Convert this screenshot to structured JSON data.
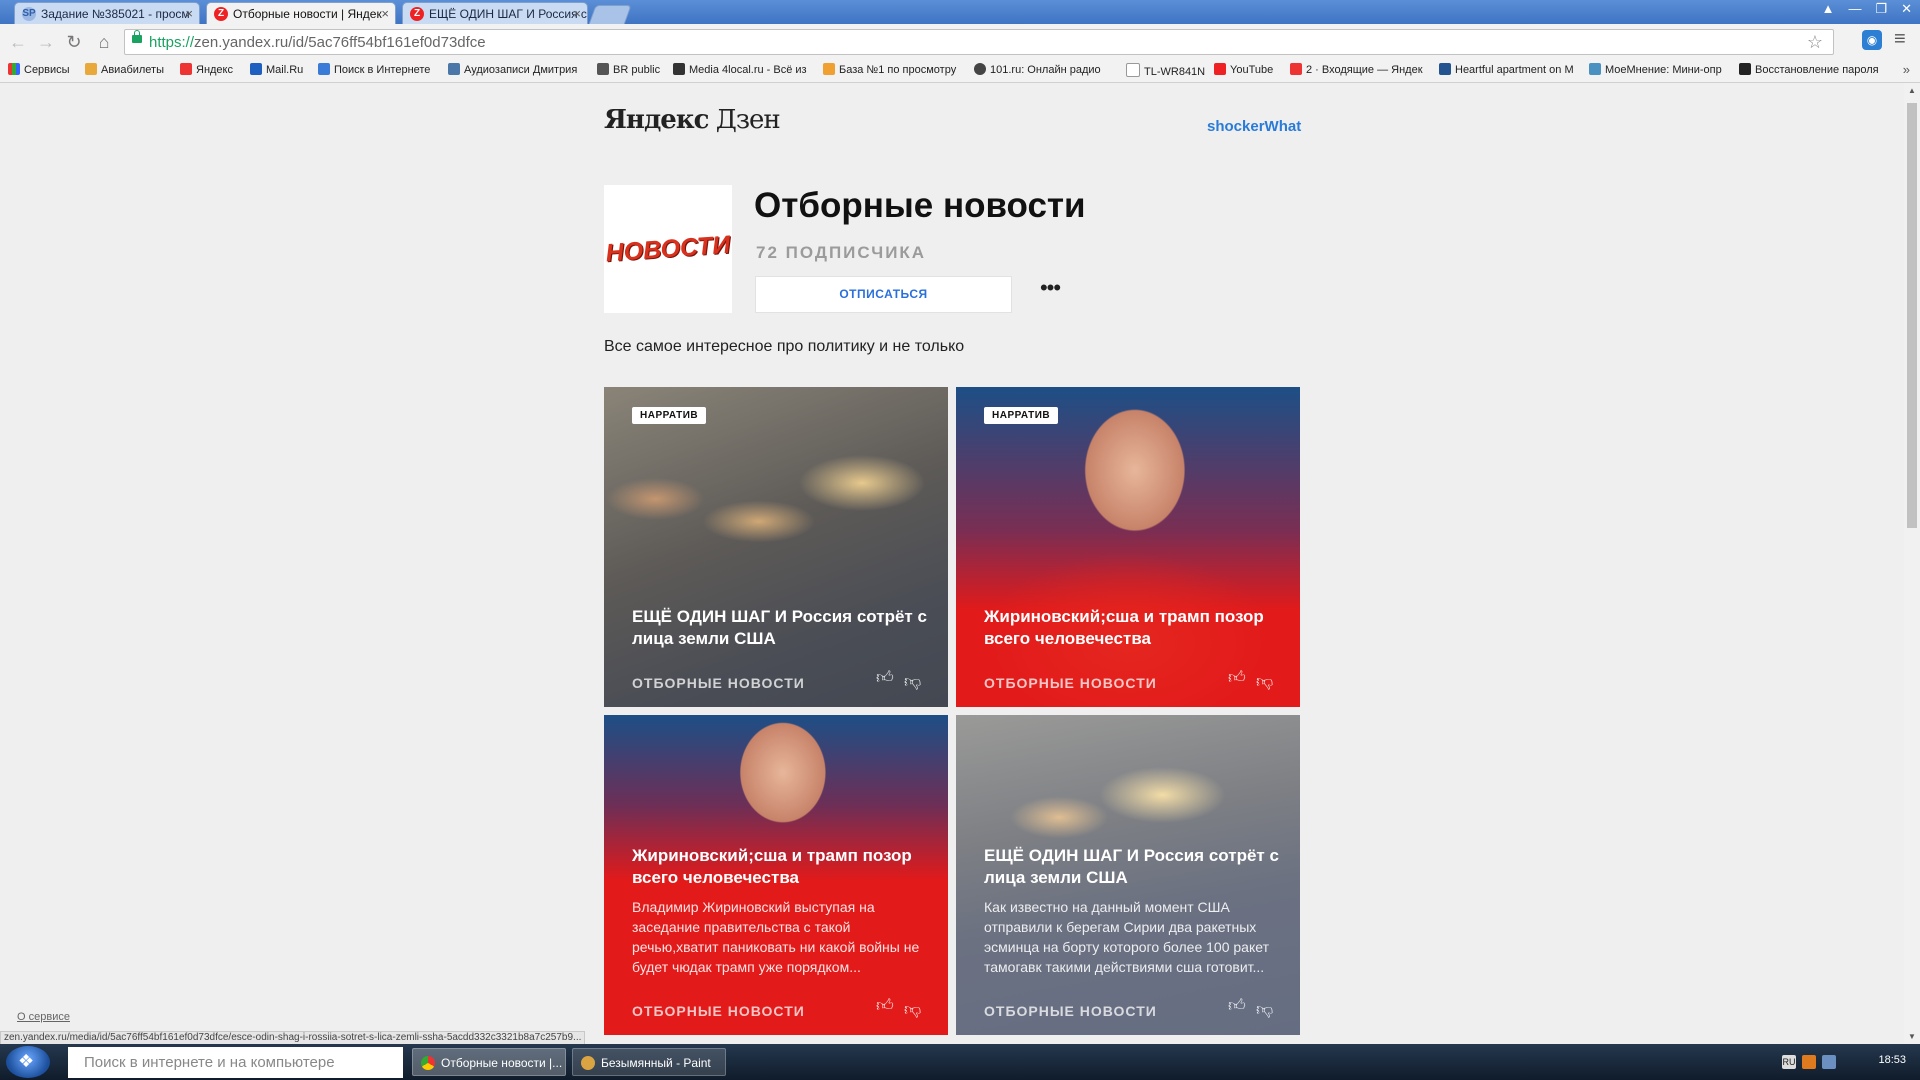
{
  "browser": {
    "tabs": [
      {
        "title": "Задание №385021 - просм",
        "favicon": "SP"
      },
      {
        "title": "Отборные новости | Яндек",
        "favicon": "Z"
      },
      {
        "title": "ЕЩЁ ОДИН ШАГ И Россия с",
        "favicon": "Z"
      }
    ],
    "url_scheme": "https://",
    "url_rest": "zen.yandex.ru/id/5ac76ff54bf161ef0d73dfce",
    "bookmarks": [
      "Сервисы",
      "Авиабилеты",
      "Яндекс",
      "Mail.Ru",
      "Поиск в Интернете",
      "Аудиозаписи Дмитрия",
      "BR public",
      "Media 4local.ru - Всё из",
      "База №1 по просмотру",
      "101.ru: Онлайн радио",
      "TL-WR841N",
      "YouTube",
      "2 · Входящие — Яндек",
      "Heartful apartment on M",
      "МоеМнение: Мини-опр",
      "Восстановление пароля"
    ],
    "bookmarks_more": "»"
  },
  "header": {
    "logo_yandex": "Яндекс",
    "logo_zen": "Дзен",
    "user": "shockerWhat"
  },
  "channel": {
    "avatar_text": "НОВОСТИ",
    "title": "Отборные новости",
    "subscribers": "72 ПОДПИСЧИКА",
    "unsubscribe": "ОТПИСАТЬСЯ",
    "more": "•••",
    "description": "Все самое интересное про политику и не только"
  },
  "cards": [
    {
      "badge": "НАРРАТИВ",
      "title": "ЕЩЁ ОДИН ШАГ И Россия сотрёт с лица земли США",
      "snippet": "",
      "source": "ОТБОРНЫЕ НОВОСТИ"
    },
    {
      "badge": "НАРРАТИВ",
      "title": "Жириновский;сша и трамп позор всего человечества",
      "snippet": "",
      "source": "ОТБОРНЫЕ НОВОСТИ"
    },
    {
      "badge": "",
      "title": "Жириновский;сша и трамп позор всего человечества",
      "snippet": "Владимир Жириновский выступая на заседание правительства с такой речью,хватит паниковать ни какой войны не будет чюдак трамп уже порядком...",
      "source": "ОТБОРНЫЕ НОВОСТИ"
    },
    {
      "badge": "",
      "title": "ЕЩЁ ОДИН ШАГ И Россия сотрёт с лица земли США",
      "snippet": "Как известно на данный момент США отправили к берегам Сирии два ракетных эсминца на борту которого более 100 ракет тамогавк такими действиями сша готовит...",
      "source": "ОТБОРНЫЕ НОВОСТИ"
    }
  ],
  "footer": {
    "about": "О сервисе",
    "status_url": "zen.yandex.ru/media/id/5ac76ff54bf161ef0d73dfce/esce-odin-shag-i-rossiia-sotret-s-lica-zemli-ssha-5acdd332c3321b8a7c257b9..."
  },
  "taskbar": {
    "search_placeholder": "Поиск в интернете и на компьютере",
    "tasks": [
      "Отборные новости |...",
      "Безымянный - Paint"
    ],
    "lang": "RU",
    "clock": "18:53"
  },
  "colors": {
    "accent": "#2a7bd8",
    "card_red": "#e21a1a",
    "card_blue": "#1f5ea0",
    "card_slate": "#56606e"
  }
}
